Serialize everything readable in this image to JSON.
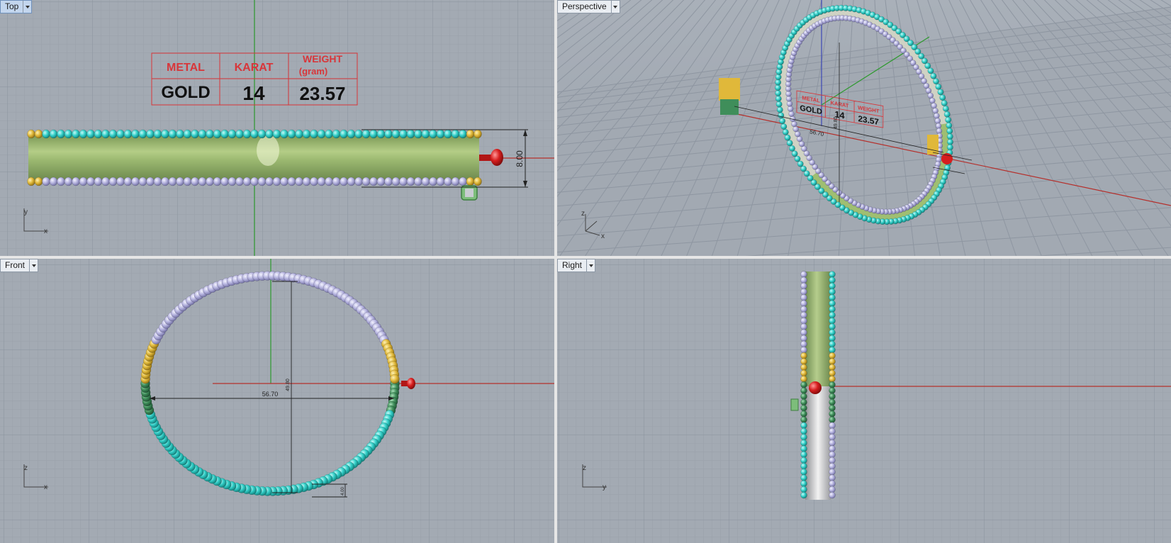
{
  "viewports": {
    "top": {
      "label": "Top",
      "active": true,
      "axes": {
        "h": "x",
        "v": "y"
      }
    },
    "perspective": {
      "label": "Perspective",
      "active": false,
      "axes": {
        "h": "x",
        "v": "z"
      }
    },
    "front": {
      "label": "Front",
      "active": false,
      "axes": {
        "h": "x",
        "v": "z"
      }
    },
    "right": {
      "label": "Right",
      "active": false,
      "axes": {
        "h": "y",
        "v": "z"
      }
    }
  },
  "info_table": {
    "headers": [
      "METAL",
      "KARAT",
      "WEIGHT",
      "(gram)"
    ],
    "values": [
      "GOLD",
      "14",
      "23.57"
    ]
  },
  "dimensions": {
    "width": "8.00",
    "diameter_h": "56.70",
    "diameter_v": "49.80",
    "small": "4.00"
  },
  "colors": {
    "viewport_bg": "#a3aab3",
    "grid_minor": "#99a0aa",
    "grid_major": "#8a929d",
    "x_axis": "#b5302c",
    "y_axis": "#2e9a2e",
    "z_axis": "#3b47b5",
    "bead_cyan": "#33cfc8",
    "bead_lavender": "#b4b2de",
    "bead_yellow": "#e0b83a",
    "bead_green": "#3f8e5a",
    "band_green": "#a6c27a",
    "band_silver": "#dcdcdc",
    "table_red": "#d8363a"
  }
}
